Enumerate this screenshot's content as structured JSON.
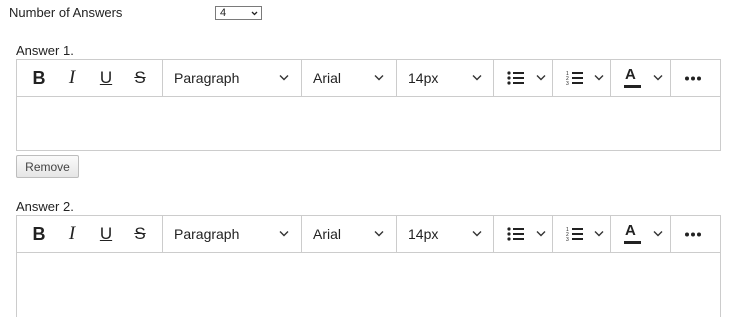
{
  "num_answers": {
    "label": "Number of Answers",
    "value": "4"
  },
  "answers": [
    {
      "label": "Answer 1.",
      "toolbar": {
        "bold": "B",
        "italic": "I",
        "underline": "U",
        "strike": "S",
        "block_format": "Paragraph",
        "font": "Arial",
        "size": "14px",
        "text_color_glyph": "A"
      },
      "remove_label": "Remove"
    },
    {
      "label": "Answer 2.",
      "toolbar": {
        "bold": "B",
        "italic": "I",
        "underline": "U",
        "strike": "S",
        "block_format": "Paragraph",
        "font": "Arial",
        "size": "14px",
        "text_color_glyph": "A"
      }
    }
  ],
  "colors": {
    "border": "#cccccc",
    "text": "#222222",
    "button_bg": "#e6e6e6"
  },
  "icons": [
    "chevron-down-icon",
    "bullet-list-icon",
    "numbered-list-icon",
    "text-color-icon",
    "more-icon"
  ]
}
